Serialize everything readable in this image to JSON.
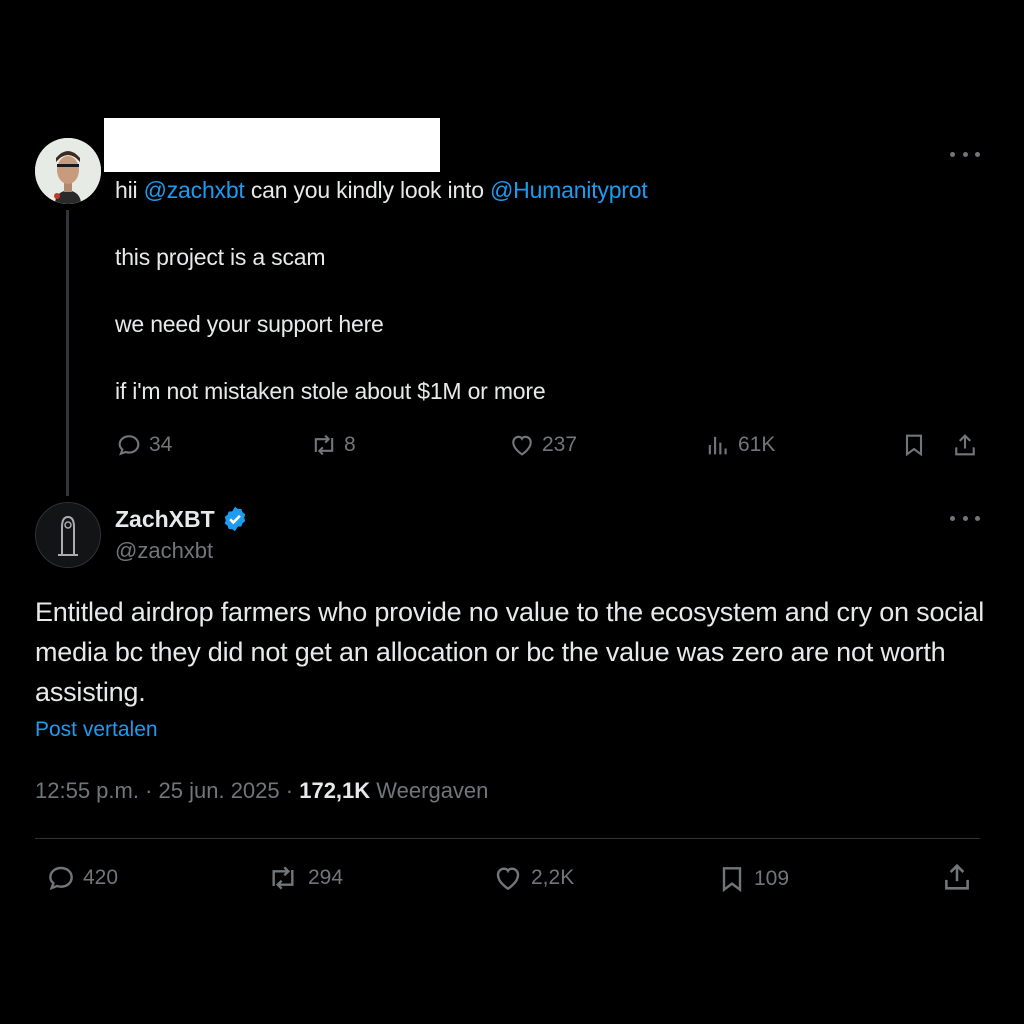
{
  "parent_tweet": {
    "text_line1_prefix": "hii ",
    "mention1": "@zachxbt",
    "text_line1_middle": " can you kindly look into ",
    "mention2": "@Humanityprot",
    "line2": "this project is a scam",
    "line3": "we need your support here",
    "line4": "if i'm not mistaken stole about $1M or more",
    "actions": {
      "replies": "34",
      "reposts": "8",
      "likes": "237",
      "views": "61K"
    }
  },
  "main_tweet": {
    "display_name": "ZachXBT",
    "handle": "@zachxbt",
    "body": "Entitled airdrop farmers who provide no value to the ecosystem and cry on social media bc they did not get an allocation or bc the value was zero are not worth assisting.",
    "translate_label": "Post vertalen",
    "time": "12:55 p.m.",
    "separator": "·",
    "date": "25 jun. 2025",
    "views_count": "172,1K",
    "views_label": "Weergaven",
    "actions": {
      "replies": "420",
      "reposts": "294",
      "likes": "2,2K",
      "bookmarks": "109"
    }
  },
  "colors": {
    "background": "#000000",
    "text": "#e7e9ea",
    "muted": "#71767b",
    "link": "#1d9bf0",
    "verified": "#1d9bf0"
  },
  "icons": [
    "more-icon",
    "reply-icon",
    "repost-icon",
    "like-icon",
    "views-icon",
    "bookmark-icon",
    "share-icon",
    "verified-badge-icon"
  ]
}
